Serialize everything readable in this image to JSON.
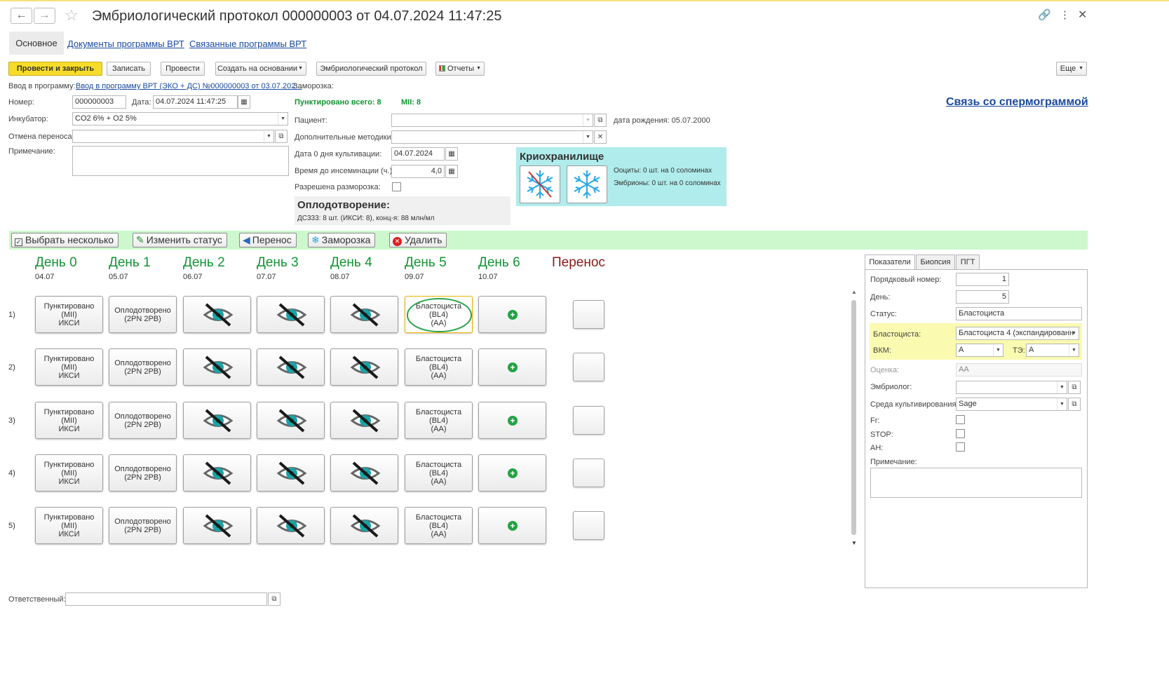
{
  "window": {
    "title": "Эмбриологический протокол 000000003 от 04.07.2024 11:47:25"
  },
  "tabs": {
    "main": "Основное",
    "docs": "Документы программы ВРТ",
    "linked": "Связанные программы ВРТ"
  },
  "toolbar": {
    "post_close": "Провести и закрыть",
    "save": "Записать",
    "post": "Провести",
    "create_based": "Создать на основании",
    "embryo_protocol": "Эмбриологический протокол",
    "reports": "Отчеты",
    "more": "Еще"
  },
  "form": {
    "program_label": "Ввод в программу:",
    "program_link": "Ввод в программу ВРТ (ЭКО + ДС) №000000003 от 03.07.202...",
    "freeze_label": "Заморозка:",
    "number_label": "Номер:",
    "number_value": "000000003",
    "date_label": "Дата:",
    "date_value": "04.07.2024 11:47:25",
    "punct_total": "Пунктировано всего: 8",
    "mii": "MII: 8",
    "spermogram_link": "Связь со спермограммой",
    "incubator_label": "Инкубатор:",
    "incubator_value": "CO2 6% + O2 5%",
    "patient_label": "Пациент:",
    "patient_value": "",
    "birth_date": "дата рождения: 05.07.2000",
    "cancel_transfer_label": "Отмена переноса:",
    "cancel_transfer_value": "",
    "extra_methods_label": "Дополнительные методики:",
    "extra_methods_value": "",
    "note_label": "Примечание:",
    "note_value": "",
    "day0_label": "Дата 0 дня культивации:",
    "day0_value": "04.07.2024",
    "insem_label": "Время до инсеминации (ч.):",
    "insem_value": "4,0",
    "thaw_label": "Разрешена разморозка:",
    "thaw_checked": false,
    "fert_title": "Оплодотворение:",
    "fert_info": "ДС333: 8 шт. (ИКСИ: 8), конц-я: 88 млн/мл",
    "responsible_label": "Ответственный:",
    "responsible_value": ""
  },
  "cryo": {
    "title": "Криохранилище",
    "oocytes": "Ооциты: 0 шт. на 0 соломинах",
    "embryos": "Эмбрионы: 0 шт. на 0 соломинах"
  },
  "actions": {
    "select_multiple": "Выбрать несколько",
    "change_status": "Изменить статус",
    "transfer": "Перенос",
    "freeze": "Заморозка",
    "delete": "Удалить"
  },
  "grid": {
    "days": [
      {
        "name": "День 0",
        "date": "04.07"
      },
      {
        "name": "День 1",
        "date": "05.07"
      },
      {
        "name": "День 2",
        "date": "06.07"
      },
      {
        "name": "День 3",
        "date": "07.07"
      },
      {
        "name": "День 4",
        "date": "08.07"
      },
      {
        "name": "День 5",
        "date": "09.07"
      },
      {
        "name": "День 6",
        "date": "10.07"
      }
    ],
    "transfer_header": "Перенос",
    "rows": [
      {
        "num": "1)",
        "d0": [
          "Пунктировано",
          "(MII)",
          "ИКСИ"
        ],
        "d1": [
          "Оплодотворено",
          "(2PN 2PB)"
        ],
        "d5": [
          "Бластоциста",
          "(BL4)",
          "(AA)"
        ]
      },
      {
        "num": "2)",
        "d0": [
          "Пунктировано",
          "(MII)",
          "ИКСИ"
        ],
        "d1": [
          "Оплодотворено",
          "(2PN 2PB)"
        ],
        "d5": [
          "Бластоциста",
          "(BL4)",
          "(AA)"
        ]
      },
      {
        "num": "3)",
        "d0": [
          "Пунктировано",
          "(MII)",
          "ИКСИ"
        ],
        "d1": [
          "Оплодотворено",
          "(2PN 2PB)"
        ],
        "d5": [
          "Бластоциста",
          "(BL4)",
          "(AA)"
        ]
      },
      {
        "num": "4)",
        "d0": [
          "Пунктировано",
          "(MII)",
          "ИКСИ"
        ],
        "d1": [
          "Оплодотворено",
          "(2PN 2PB)"
        ],
        "d5": [
          "Бластоциста",
          "(BL4)",
          "(AA)"
        ]
      },
      {
        "num": "5)",
        "d0": [
          "Пунктировано",
          "(MII)",
          "ИКСИ"
        ],
        "d1": [
          "Оплодотворено",
          "(2PN 2PB)"
        ],
        "d5": [
          "Бластоциста",
          "(BL4)",
          "(AA)"
        ]
      }
    ]
  },
  "right_panel": {
    "tabs": [
      "Показатели",
      "Биопсия",
      "ПГТ"
    ],
    "seq_label": "Порядковый номер:",
    "seq_value": "1",
    "day_label": "День:",
    "day_value": "5",
    "status_label": "Статус:",
    "status_value": "Бластоциста",
    "blast_label": "Бластоциста:",
    "blast_value": "Бластоциста 4 (экспандированн",
    "vkm_label": "ВКМ:",
    "vkm_value": "A",
    "te_label": "ТЭ:",
    "te_value": "A",
    "grade_label": "Оценка:",
    "grade_value": "AA",
    "embryologist_label": "Эмбриолог:",
    "embryologist_value": "",
    "medium_label": "Среда культивирования:",
    "medium_value": "Sage",
    "fr_label": "Fr:",
    "stop_label": "STOP:",
    "ah_label": "AH:",
    "note_label": "Примечание:",
    "note_value": ""
  },
  "colors": {
    "accent_green": "#129432",
    "transfer_red": "#8b1a1a",
    "yellow_button": "#f8dc2c",
    "cryo_bg": "#b0ecec",
    "toolbar_bg": "#cdf8cd",
    "highlight_bg": "#fafab0"
  }
}
